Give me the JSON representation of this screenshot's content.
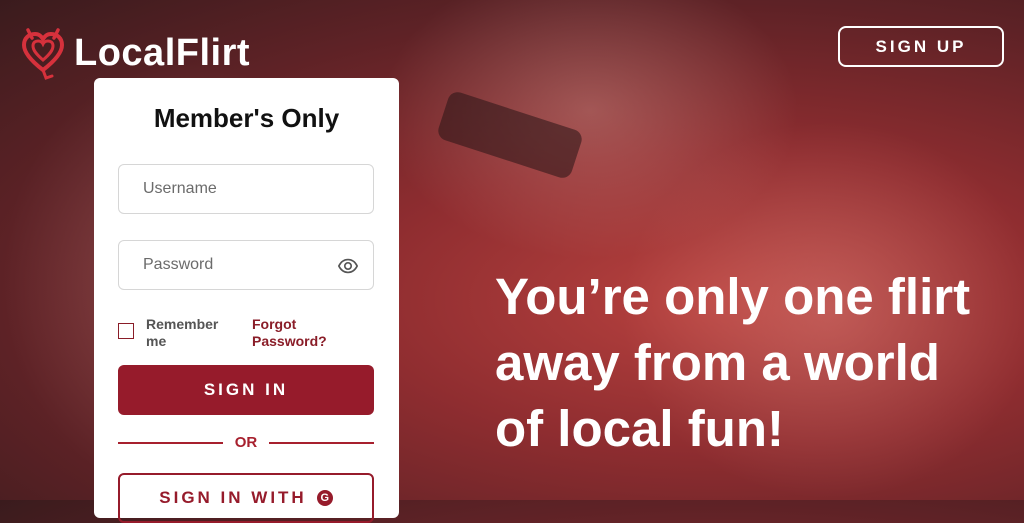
{
  "brand": {
    "name": "LocalFlirt",
    "accent": "#961b2b"
  },
  "header": {
    "signup_label": "SIGN UP"
  },
  "login": {
    "title": "Member's Only",
    "username_placeholder": "Username",
    "password_placeholder": "Password",
    "remember_label": "Remember me",
    "forgot_label": "Forgot Password?",
    "signin_label": "SIGN IN",
    "or_label": "OR",
    "signin_with_label": "SIGN IN WITH",
    "signin_with_icon": "google-icon"
  },
  "hero": {
    "headline": "You’re only one flirt away from a world of local fun!"
  }
}
